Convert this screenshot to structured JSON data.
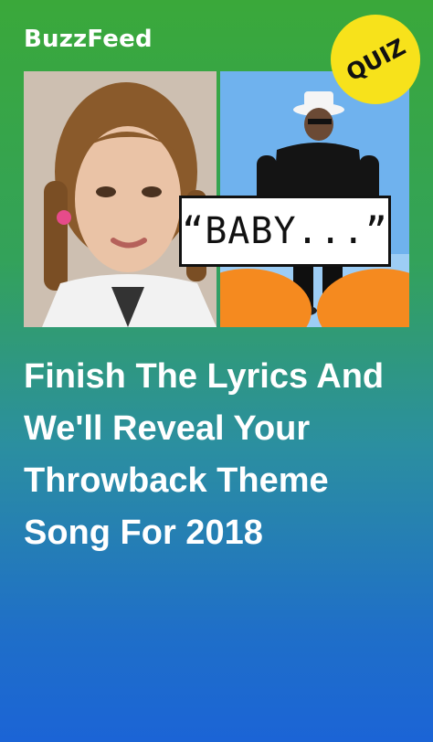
{
  "brand": {
    "name": "BuzzFeed"
  },
  "badge": {
    "label": "QUIZ"
  },
  "lyric_box": {
    "text": "“BABY...”"
  },
  "headline": {
    "text": "Finish The Lyrics And We'll Reveal Your Throwback Theme Song For 2018"
  },
  "colors": {
    "badge": "#f7e21b",
    "gradient_top": "#3aa83a",
    "gradient_bottom": "#1b64d6",
    "text": "#ffffff"
  }
}
